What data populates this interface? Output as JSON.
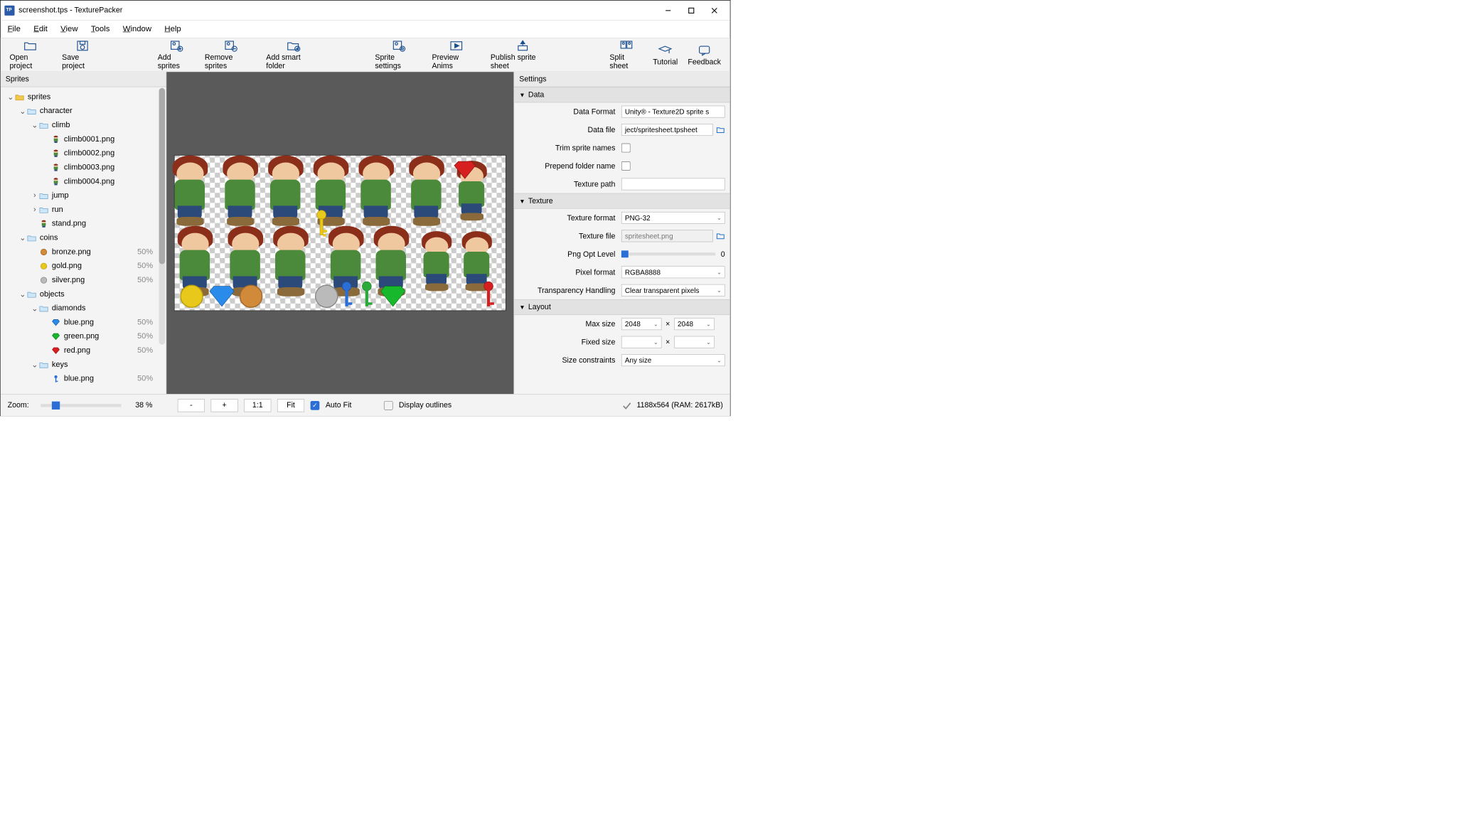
{
  "window": {
    "title": "screenshot.tps - TexturePacker"
  },
  "menu": [
    "File",
    "Edit",
    "View",
    "Tools",
    "Window",
    "Help"
  ],
  "toolbar": [
    {
      "id": "open-project",
      "label": "Open project"
    },
    {
      "id": "save-project",
      "label": "Save project"
    },
    {
      "id": "add-sprites",
      "label": "Add sprites"
    },
    {
      "id": "remove-sprites",
      "label": "Remove sprites"
    },
    {
      "id": "add-smart-folder",
      "label": "Add smart folder"
    },
    {
      "id": "sprite-settings",
      "label": "Sprite settings"
    },
    {
      "id": "preview-anims",
      "label": "Preview Anims"
    },
    {
      "id": "publish",
      "label": "Publish sprite sheet"
    },
    {
      "id": "split-sheet",
      "label": "Split sheet"
    },
    {
      "id": "tutorial",
      "label": "Tutorial"
    },
    {
      "id": "feedback",
      "label": "Feedback"
    }
  ],
  "left_panel_title": "Sprites",
  "tree": [
    {
      "d": 1,
      "exp": true,
      "ico": "folder-yellow",
      "label": "sprites"
    },
    {
      "d": 2,
      "exp": true,
      "ico": "folder",
      "label": "character"
    },
    {
      "d": 3,
      "exp": true,
      "ico": "folder",
      "label": "climb"
    },
    {
      "d": 4,
      "ico": "char",
      "label": "climb0001.png"
    },
    {
      "d": 4,
      "ico": "char",
      "label": "climb0002.png"
    },
    {
      "d": 4,
      "ico": "char",
      "label": "climb0003.png"
    },
    {
      "d": 4,
      "ico": "char",
      "label": "climb0004.png"
    },
    {
      "d": 3,
      "exp": false,
      "ico": "folder",
      "label": "jump"
    },
    {
      "d": 3,
      "exp": false,
      "ico": "folder",
      "label": "run"
    },
    {
      "d": 3,
      "ico": "char",
      "label": "stand.png"
    },
    {
      "d": 2,
      "exp": true,
      "ico": "folder",
      "label": "coins"
    },
    {
      "d": 3,
      "ico": "coin-bronze",
      "label": "bronze.png",
      "meta": "50%"
    },
    {
      "d": 3,
      "ico": "coin-gold",
      "label": "gold.png",
      "meta": "50%"
    },
    {
      "d": 3,
      "ico": "coin-silver",
      "label": "silver.png",
      "meta": "50%"
    },
    {
      "d": 2,
      "exp": true,
      "ico": "folder",
      "label": "objects"
    },
    {
      "d": 3,
      "exp": true,
      "ico": "folder",
      "label": "diamonds"
    },
    {
      "d": 4,
      "ico": "diamond-blue",
      "label": "blue.png",
      "meta": "50%"
    },
    {
      "d": 4,
      "ico": "diamond-green",
      "label": "green.png",
      "meta": "50%"
    },
    {
      "d": 4,
      "ico": "diamond-red",
      "label": "red.png",
      "meta": "50%"
    },
    {
      "d": 3,
      "exp": true,
      "ico": "folder",
      "label": "keys"
    },
    {
      "d": 4,
      "ico": "key-blue",
      "label": "blue.png",
      "meta": "50%"
    }
  ],
  "right_panel_title": "Settings",
  "sections": {
    "data": {
      "title": "Data",
      "data_format_lbl": "Data Format",
      "data_format_val": "Unity® - Texture2D sprite s",
      "data_file_lbl": "Data file",
      "data_file_val": "ject/spritesheet.tpsheet",
      "trim_lbl": "Trim sprite names",
      "trim_val": false,
      "prepend_lbl": "Prepend folder name",
      "prepend_val": false,
      "texpath_lbl": "Texture path",
      "texpath_val": ""
    },
    "texture": {
      "title": "Texture",
      "texformat_lbl": "Texture format",
      "texformat_val": "PNG-32",
      "texfile_lbl": "Texture file",
      "texfile_val": "spritesheet.png",
      "pngopt_lbl": "Png Opt Level",
      "pngopt_val": "0",
      "pixfmt_lbl": "Pixel format",
      "pixfmt_val": "RGBA8888",
      "trans_lbl": "Transparency Handling",
      "trans_val": "Clear transparent pixels"
    },
    "layout": {
      "title": "Layout",
      "maxsize_lbl": "Max size",
      "maxsize_w": "2048",
      "maxsize_h": "2048",
      "fixedsize_lbl": "Fixed size",
      "fixedsize_w": "",
      "fixedsize_h": "",
      "sizecon_lbl": "Size constraints",
      "sizecon_val": "Any size"
    }
  },
  "status": {
    "zoom_lbl": "Zoom:",
    "zoom_pct": "38 %",
    "minus": "-",
    "plus": "+",
    "onetoone": "1:1",
    "fit": "Fit",
    "autofit": "Auto Fit",
    "outlines": "Display outlines",
    "sheet_info": "1188x564 (RAM: 2617kB)"
  }
}
